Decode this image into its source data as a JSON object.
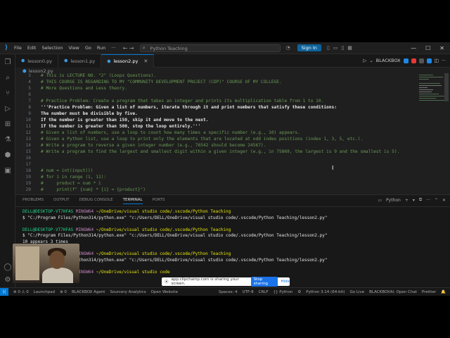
{
  "titlebar": {
    "menus": [
      "File",
      "Edit",
      "Selection",
      "View",
      "Go",
      "Run",
      "···"
    ],
    "nav": "← →",
    "search": "Python Teaching",
    "signin": "Sign In",
    "win": [
      "—",
      "☐",
      "✕"
    ]
  },
  "tabs": [
    {
      "label": "lesson0.py",
      "active": false
    },
    {
      "label": "lesson1.py",
      "active": false
    },
    {
      "label": "lesson2.py",
      "active": true
    }
  ],
  "editor_actions": {
    "run_label": "BLACKBOX"
  },
  "breadcrumb": "lesson2.py",
  "code_lines": [
    {
      "n": "3",
      "t": "# This is LECTURE NO. \"2\" (Loops Questions).",
      "c": "c-comment"
    },
    {
      "n": "4",
      "t": "# THIS COURSE IS REGARDING TO MY \"COMMUNITY DEVELOPMENT PROJECT (CDP)\" COURSE OF MY COLLEGE.",
      "c": "c-comment"
    },
    {
      "n": "5",
      "t": "# More Questions and Less theory.",
      "c": "c-comment"
    },
    {
      "n": "6",
      "t": "",
      "c": "c-comment"
    },
    {
      "n": "7",
      "t": "# Practice Problem: Create a program that takes an integer and prints its multiplication table from 1 to 10.",
      "c": "c-comment"
    },
    {
      "n": "8",
      "t": "'''Practice Problem: Given a list of numbers, iterate through it and print numbers that satisfy these conditions:",
      "c": "c-white"
    },
    {
      "n": "9",
      "t": "The number must be divisible by five.",
      "c": "c-white"
    },
    {
      "n": "10",
      "t": "If the number is greater than 150, skip it and move to the next.",
      "c": "c-white"
    },
    {
      "n": "11",
      "t": "If the number is greater than 500, stop the loop entirely.'''",
      "c": "c-white"
    },
    {
      "n": "12",
      "t": "# Given a list of numbers, use a loop to count how many times a specific number (e.g., 10) appears.",
      "c": "c-comment"
    },
    {
      "n": "13",
      "t": "# Given a Python list, use a loop to print only the elements that are located at odd index positions (index 1, 3, 5, etc.).",
      "c": "c-comment"
    },
    {
      "n": "14",
      "t": "# Write a program to reverse a given integer number (e.g., 76542 should become 24567).",
      "c": "c-comment"
    },
    {
      "n": "15",
      "t": "# Write a program to find the largest and smallest digit within a given integer (e.g., in 75869, the largest is 9 and the smallest is 5).",
      "c": "c-comment"
    },
    {
      "n": "16",
      "t": "",
      "c": "c-comment"
    },
    {
      "n": "17",
      "t": "",
      "c": "c-comment"
    },
    {
      "n": "18",
      "t": "# num = int(input())",
      "c": "c-comment"
    },
    {
      "n": "19",
      "t": "# for i in range (1, 11):",
      "c": "c-comment"
    },
    {
      "n": "19",
      "t": "#     product = num * i",
      "c": "c-comment"
    },
    {
      "n": "20",
      "t": "#     print(f\" {num} * {i} = {product}\")",
      "c": "c-comment"
    }
  ],
  "panel": {
    "tabs": [
      "PROBLEMS",
      "OUTPUT",
      "DEBUG CONSOLE",
      "TERMINAL",
      "PORTS"
    ],
    "active": "TERMINAL",
    "shell": "Python",
    "actions": [
      "+",
      "▾",
      "⧉",
      "···",
      "⌃",
      "✕"
    ]
  },
  "terminal": [
    {
      "type": "prompt",
      "user": "DELL@DESKTOP-VT7HFAS",
      "host": "MINGW64",
      "path": "~/OneDrive/visual studio code/.vscode/Python Teaching"
    },
    {
      "type": "cmd",
      "text": "$ \"C:/Program Files/Python314/python.exe\" \"c:/Users/DELL/OneDrive/visual studio code/.vscode/Python Teaching/lesson2.py\""
    },
    {
      "type": "blank",
      "text": ""
    },
    {
      "type": "prompt",
      "user": "DELL@DESKTOP-VT7HFAS",
      "host": "MINGW64",
      "path": "~/OneDrive/visual studio code/.vscode/Python Teaching"
    },
    {
      "type": "cmd",
      "text": "$ \"C:/Program Files/Python314/python.exe\" \"c:/Users/DELL/OneDrive/visual studio code/.vscode/Python Teaching/lesson2.py\""
    },
    {
      "type": "out",
      "text": "10 appears 3 times"
    },
    {
      "type": "blank",
      "text": ""
    },
    {
      "type": "prompt",
      "user": "DELL@DESKTOP-VT7HFAS",
      "host": "MINGW64",
      "path": "~/OneDrive/visual studio code/.vscode/Python Teaching"
    },
    {
      "type": "cmd",
      "text": "$ \"C:/Program Files/Python314/python.exe\" \"c:/Users/DELL/OneDrive/visual studio code/.vscode/Python Teaching/lesson2.py\""
    },
    {
      "type": "blank",
      "text": ""
    },
    {
      "type": "prompt",
      "user": "DELL@DESKTOP-VT7HFAS",
      "host": "MINGW64",
      "path": "~/OneDrive/visual studio code"
    },
    {
      "type": "cmd",
      "text": "$"
    }
  ],
  "share": {
    "text": "app.clipchamp.com is sharing your screen.",
    "stop": "Stop sharing",
    "hide": "Hide"
  },
  "statusbar": {
    "left": [
      "⊗ 0 ⚠ 0",
      "Launchpad",
      "⊕ 0",
      "BLACKBOX Agent",
      "Sourcery Analytics",
      "Open Website"
    ],
    "right": [
      "Spaces: 4",
      "UTF-8",
      "CRLF",
      "{} Python",
      "⚙",
      "Python 3.14 (64-bit)",
      "Go Live",
      "BLACKBOXAI: Open Chat",
      "Prettier",
      "🔔"
    ]
  }
}
